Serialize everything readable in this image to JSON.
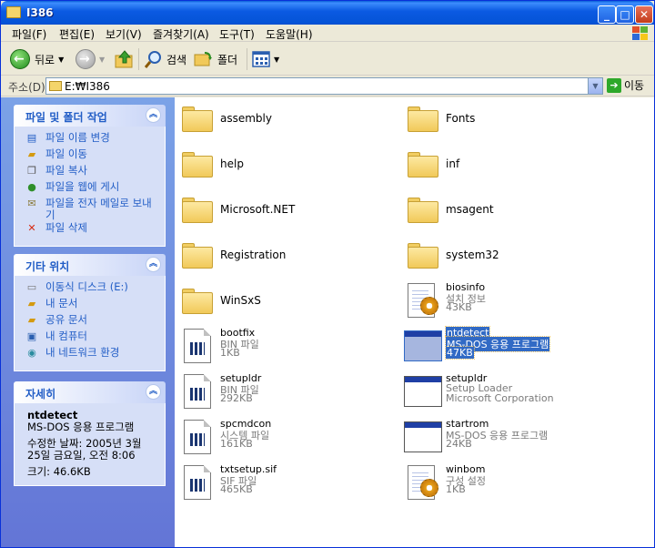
{
  "window": {
    "title": "I386"
  },
  "menu": [
    "파일(F)",
    "편집(E)",
    "보기(V)",
    "즐겨찾기(A)",
    "도구(T)",
    "도움말(H)"
  ],
  "toolbar": {
    "back_label": "뒤로",
    "search_label": "검색",
    "folders_label": "폴더"
  },
  "address": {
    "label": "주소(D)",
    "value": "E:₩I386",
    "go_label": "이동"
  },
  "left_pane": {
    "file_tasks": {
      "title": "파일 및 폴더 작업",
      "items": [
        {
          "label": "파일 이름 변경",
          "icon": "rename-icon"
        },
        {
          "label": "파일 이동",
          "icon": "move-icon"
        },
        {
          "label": "파일 복사",
          "icon": "copy-icon"
        },
        {
          "label": "파일을 웹에 게시",
          "icon": "web-publish-icon"
        },
        {
          "label": "파일을 전자 메일로 보내기",
          "icon": "email-icon"
        },
        {
          "label": "파일 삭제",
          "icon": "delete-icon"
        }
      ]
    },
    "other_places": {
      "title": "기타 위치",
      "items": [
        {
          "label": "이동식 디스크 (E:)",
          "icon": "removable-disk-icon"
        },
        {
          "label": "내 문서",
          "icon": "my-documents-icon"
        },
        {
          "label": "공유 문서",
          "icon": "shared-documents-icon"
        },
        {
          "label": "내 컴퓨터",
          "icon": "my-computer-icon"
        },
        {
          "label": "내 네트워크 환경",
          "icon": "network-icon"
        }
      ]
    },
    "details": {
      "title": "자세히",
      "name": "ntdetect",
      "type": "MS-DOS 응용 프로그램",
      "modified": "수정한 날짜: 2005년 3월 25일 금요일, 오전 8:06",
      "size": "크기: 46.6KB"
    }
  },
  "items": [
    {
      "name": "assembly",
      "kind": "folder"
    },
    {
      "name": "Fonts",
      "kind": "folder"
    },
    {
      "name": "help",
      "kind": "folder"
    },
    {
      "name": "inf",
      "kind": "folder"
    },
    {
      "name": "Microsoft.NET",
      "kind": "folder"
    },
    {
      "name": "msagent",
      "kind": "folder"
    },
    {
      "name": "Registration",
      "kind": "folder"
    },
    {
      "name": "system32",
      "kind": "folder"
    },
    {
      "name": "WinSxS",
      "kind": "folder"
    },
    {
      "name": "biosinfo",
      "kind": "config",
      "line1": "설치 정보",
      "line2": "43KB"
    },
    {
      "name": "bootfix",
      "kind": "file",
      "line1": "BIN 파일",
      "line2": "1KB"
    },
    {
      "name": "ntdetect",
      "kind": "app",
      "line1": "MS-DOS 응용 프로그램",
      "line2": "47KB",
      "selected": true
    },
    {
      "name": "setupldr",
      "kind": "file",
      "line1": "BIN 파일",
      "line2": "292KB"
    },
    {
      "name": "setupldr",
      "kind": "app",
      "line1": "Setup Loader",
      "line2": "Microsoft Corporation"
    },
    {
      "name": "spcmdcon",
      "kind": "file",
      "line1": "시스템 파일",
      "line2": "161KB"
    },
    {
      "name": "startrom",
      "kind": "app",
      "line1": "MS-DOS 응용 프로그램",
      "line2": "24KB"
    },
    {
      "name": "txtsetup.sif",
      "kind": "file",
      "line1": "SIF 파일",
      "line2": "465KB"
    },
    {
      "name": "winbom",
      "kind": "config",
      "line1": "구성 설정",
      "line2": "1KB"
    }
  ]
}
